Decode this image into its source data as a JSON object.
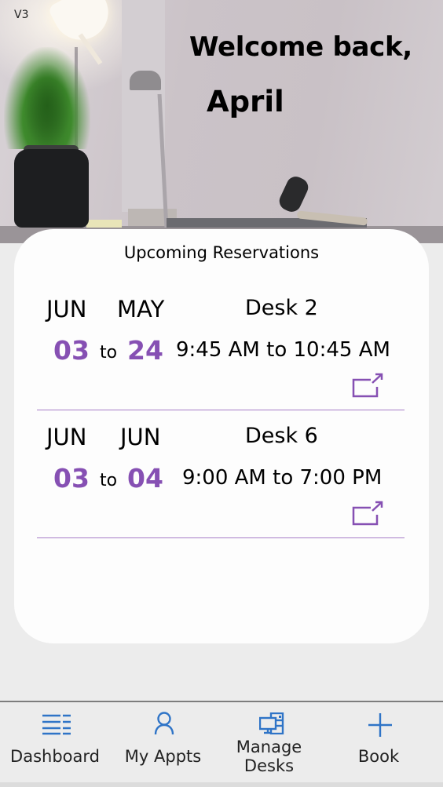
{
  "app": {
    "version": "V3"
  },
  "header": {
    "greeting": "Welcome back,",
    "user_name": "April"
  },
  "reservations_card": {
    "title": "Upcoming Reservations",
    "connector": "to",
    "items": [
      {
        "start_month": "JUN",
        "end_month": "MAY",
        "start_day": "03",
        "end_day": "24",
        "desk": "Desk 2",
        "time_range": "9:45 AM to 10:45 AM",
        "action_icon": "open-external-icon"
      },
      {
        "start_month": "JUN",
        "end_month": "JUN",
        "start_day": "03",
        "end_day": "04",
        "desk": "Desk 6",
        "time_range": "9:00 AM to 7:00 PM",
        "action_icon": "open-external-icon"
      }
    ]
  },
  "nav": {
    "items": [
      {
        "label": "Dashboard",
        "icon": "list-icon"
      },
      {
        "label": "My Appts",
        "icon": "person-icon"
      },
      {
        "label": "Manage Desks",
        "icon": "desktop-icon"
      },
      {
        "label": "Book",
        "icon": "plus-icon"
      }
    ]
  },
  "colors": {
    "accent": "#8650b3",
    "divider": "#a67dc7",
    "nav_icon": "#2f74c7",
    "background": "#ececec",
    "card": "#fdfdfd"
  }
}
